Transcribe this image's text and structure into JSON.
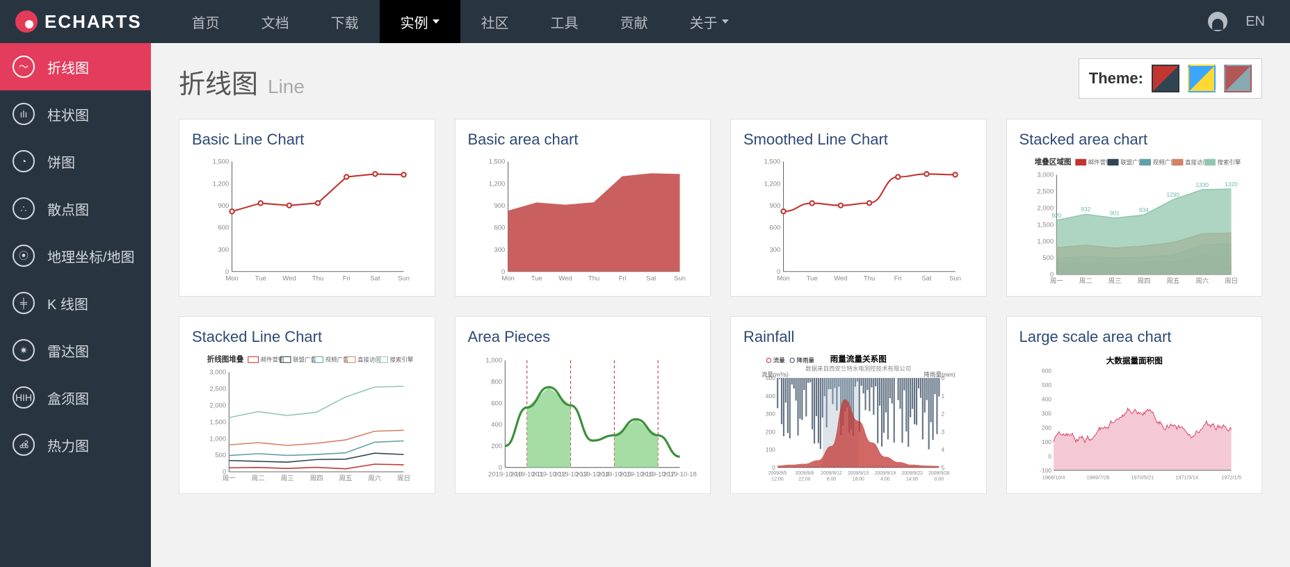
{
  "brand": "ECHARTS",
  "nav": {
    "items": [
      "首页",
      "文档",
      "下载",
      "实例",
      "社区",
      "工具",
      "贡献",
      "关于"
    ],
    "activeIndex": 3,
    "dropdownIndices": [
      3,
      7
    ]
  },
  "lang": "EN",
  "sidebar": {
    "activeIndex": 0,
    "items": [
      {
        "label": "折线图",
        "glyph": "〜"
      },
      {
        "label": "柱状图",
        "glyph": "ılı"
      },
      {
        "label": "饼图",
        "glyph": "◔"
      },
      {
        "label": "散点图",
        "glyph": "∴"
      },
      {
        "label": "地理坐标/地图",
        "glyph": "⦿"
      },
      {
        "label": "K 线图",
        "glyph": "╪"
      },
      {
        "label": "雷达图",
        "glyph": "✷"
      },
      {
        "label": "盒须图",
        "glyph": "HIH"
      },
      {
        "label": "热力图",
        "glyph": "ൿ"
      }
    ]
  },
  "page": {
    "title_zh": "折线图",
    "title_en": "Line"
  },
  "theme": {
    "label": "Theme:",
    "selected": 0
  },
  "cards": [
    {
      "title": "Basic Line Chart"
    },
    {
      "title": "Basic area chart"
    },
    {
      "title": "Smoothed Line Chart"
    },
    {
      "title": "Stacked area chart"
    },
    {
      "title": "Stacked Line Chart"
    },
    {
      "title": "Area Pieces"
    },
    {
      "title": "Rainfall"
    },
    {
      "title": "Large scale area chart"
    }
  ],
  "chart_data": [
    {
      "type": "line",
      "title": "Basic Line Chart",
      "categories": [
        "Mon",
        "Tue",
        "Wed",
        "Thu",
        "Fri",
        "Sat",
        "Sun"
      ],
      "values": [
        820,
        932,
        901,
        934,
        1290,
        1330,
        1320
      ],
      "ylabel": "",
      "ylim": [
        0,
        1500
      ],
      "yticks": [
        0,
        300,
        600,
        900,
        1200,
        1500
      ]
    },
    {
      "type": "area",
      "title": "Basic area chart",
      "categories": [
        "Mon",
        "Tue",
        "Wed",
        "Thu",
        "Fri",
        "Sat",
        "Sun"
      ],
      "values": [
        820,
        932,
        901,
        934,
        1290,
        1330,
        1320
      ],
      "ylim": [
        0,
        1500
      ],
      "yticks": [
        0,
        300,
        600,
        900,
        1200,
        1500
      ],
      "fill": "#c9605f"
    },
    {
      "type": "line",
      "title": "Smoothed Line Chart",
      "smooth": true,
      "categories": [
        "Mon",
        "Tue",
        "Wed",
        "Thu",
        "Fri",
        "Sat",
        "Sun"
      ],
      "values": [
        820,
        932,
        901,
        934,
        1290,
        1330,
        1320
      ],
      "ylim": [
        0,
        1500
      ],
      "yticks": [
        0,
        300,
        600,
        900,
        1200,
        1500
      ]
    },
    {
      "type": "area",
      "title": "堆叠区域图",
      "stacked": true,
      "categories": [
        "周一",
        "周二",
        "周三",
        "周四",
        "周五",
        "周六",
        "周日"
      ],
      "legend": [
        "邮件营销",
        "联盟广告",
        "视频广告",
        "直接访问",
        "搜索引擎"
      ],
      "series": [
        {
          "name": "邮件营销",
          "values": [
            120,
            132,
            101,
            134,
            90,
            230,
            210
          ]
        },
        {
          "name": "联盟广告",
          "values": [
            220,
            182,
            191,
            234,
            290,
            330,
            310
          ]
        },
        {
          "name": "视频广告",
          "values": [
            150,
            232,
            201,
            154,
            190,
            330,
            410
          ]
        },
        {
          "name": "直接访问",
          "values": [
            320,
            332,
            301,
            334,
            390,
            330,
            320
          ]
        },
        {
          "name": "搜索引擎",
          "values": [
            820,
            932,
            901,
            934,
            1290,
            1330,
            1320
          ]
        }
      ],
      "top_labels": [
        820,
        932,
        901,
        934,
        1290,
        1330,
        1320
      ],
      "ylim": [
        0,
        3000
      ],
      "yticks": [
        0,
        500,
        1000,
        1500,
        2000,
        2500,
        3000
      ]
    },
    {
      "type": "line",
      "title": "折线图堆叠",
      "categories": [
        "周一",
        "周二",
        "周三",
        "周四",
        "周五",
        "周六",
        "周日"
      ],
      "legend": [
        "邮件营销",
        "联盟广告",
        "视频广告",
        "直接访问",
        "搜索引擎"
      ],
      "series": [
        {
          "name": "邮件营销",
          "values": [
            120,
            132,
            101,
            134,
            90,
            230,
            210
          ]
        },
        {
          "name": "联盟广告",
          "values": [
            220,
            182,
            191,
            234,
            290,
            330,
            310
          ]
        },
        {
          "name": "视频广告",
          "values": [
            150,
            232,
            201,
            154,
            190,
            330,
            410
          ]
        },
        {
          "name": "直接访问",
          "values": [
            320,
            332,
            301,
            334,
            390,
            330,
            320
          ]
        },
        {
          "name": "搜索引擎",
          "values": [
            820,
            932,
            901,
            934,
            1290,
            1330,
            1320
          ]
        }
      ],
      "stacked": true,
      "ylim": [
        0,
        3000
      ],
      "yticks": [
        0,
        500,
        1000,
        1500,
        2000,
        2500,
        3000
      ]
    },
    {
      "type": "area",
      "title": "Area Pieces",
      "x": [
        "2019-10-10",
        "2019-10-11",
        "2019-10-12",
        "2019-10-13",
        "2019-10-14",
        "2019-10-15",
        "2019-10-16",
        "2019-10-17",
        "2019-10-18"
      ],
      "values": [
        200,
        560,
        750,
        580,
        250,
        300,
        450,
        300,
        100
      ],
      "ylim": [
        0,
        1000
      ],
      "yticks": [
        0,
        200,
        400,
        600,
        800,
        1000
      ],
      "highlight_bands": [
        [
          "2019-10-11",
          "2019-10-13"
        ],
        [
          "2019-10-15",
          "2019-10-17"
        ]
      ],
      "line_color": "#3c8f3c",
      "band_color": "#8ed58e"
    },
    {
      "type": "line",
      "title": "雨量流量关系图",
      "subtitle": "数据来自西安兰特水电测控技术有限公司",
      "legend": [
        "流量",
        "降雨量"
      ],
      "x_ticks": [
        "2009/9/5 12:00",
        "2009/9/8 22:00",
        "2009/9/12 8:00",
        "2009/9/15 18:00",
        "2009/9/19 4:00",
        "2009/9/22 14:00",
        "2009/9/26 0:00"
      ],
      "y_left": {
        "label": "流量(m³/s)",
        "lim": [
          0,
          500
        ],
        "ticks": [
          0,
          100,
          200,
          300,
          400,
          500
        ]
      },
      "y_right": {
        "label": "降雨量(mm)",
        "lim": [
          0,
          5
        ],
        "ticks": [
          0,
          1,
          2,
          3,
          4,
          5
        ],
        "inverted": true
      },
      "note": "dense hourly series — values summarized by shape",
      "flow_peak_approx": 380,
      "rain_bars": "irregular downward bars across full range"
    },
    {
      "type": "area",
      "title": "大数据量面积图",
      "x_ticks": [
        "1968/10/4",
        "1969/7/28",
        "1970/5/21",
        "1971/3/14",
        "1972/1/5"
      ],
      "ylim": [
        -100,
        600
      ],
      "yticks": [
        -100,
        0,
        100,
        200,
        300,
        400,
        500,
        600
      ],
      "note": "random-walk style dense series",
      "color": "#d94b6e"
    }
  ]
}
